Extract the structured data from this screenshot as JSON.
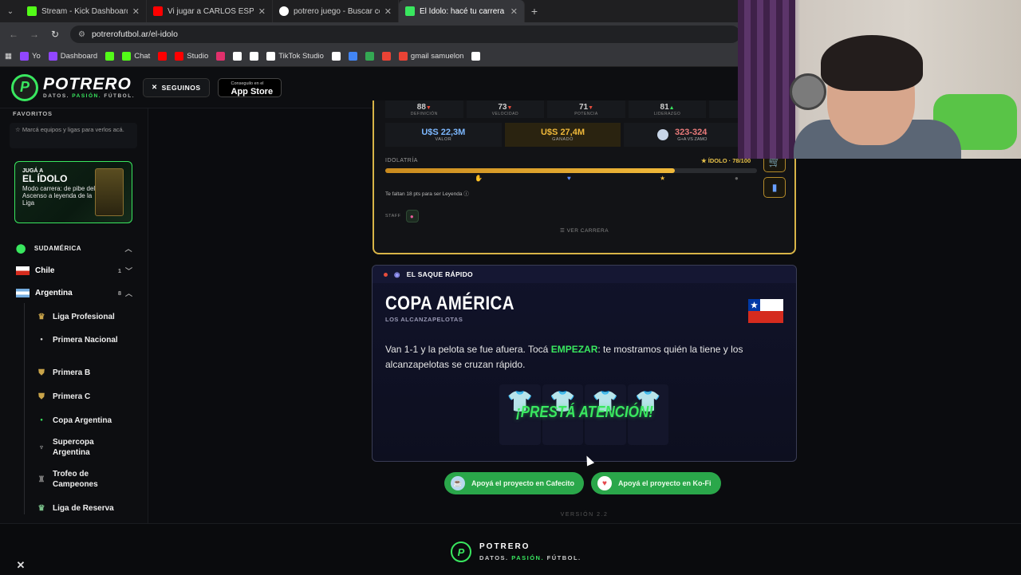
{
  "browser": {
    "tabs": [
      {
        "title": "Stream - Kick Dashboard",
        "color": "#53fc18",
        "glyph": "K"
      },
      {
        "title": "Vi jugar a CARLOS ESPÍ y descu",
        "color": "#ff0000",
        "glyph": "▶"
      },
      {
        "title": "potrero juego - Buscar con Go",
        "color": "#ffffff",
        "glyph": "G"
      },
      {
        "title": "El Ídolo: hacé tu carrera en la L",
        "color": "#39e75f",
        "glyph": "P"
      }
    ],
    "url": "potrerofutbol.ar/el-idolo",
    "bookmarks": [
      {
        "label": "Yo",
        "color": "#9146ff"
      },
      {
        "label": "Dashboard",
        "color": "#9146ff"
      },
      {
        "label": "",
        "color": "#53fc18"
      },
      {
        "label": "Chat",
        "color": "#53fc18"
      },
      {
        "label": "",
        "color": "#ff0000"
      },
      {
        "label": "Studio",
        "color": "#ff0000"
      },
      {
        "label": "",
        "color": "#e1306c"
      },
      {
        "label": "",
        "color": "#ffffff"
      },
      {
        "label": "",
        "color": "#ffffff"
      },
      {
        "label": "TikTok Studio",
        "color": "#ffffff"
      },
      {
        "label": "",
        "color": "#ffffff"
      },
      {
        "label": "",
        "color": "#4285f4"
      },
      {
        "label": "",
        "color": "#34a853"
      },
      {
        "label": "",
        "color": "#ea4335"
      },
      {
        "label": "gmail samuelon",
        "color": "#ea4335"
      },
      {
        "label": "",
        "color": "#ffffff"
      }
    ]
  },
  "header": {
    "brand": "POTRERO",
    "tagline_a": "DATOS.",
    "tagline_b": "PASIÓN.",
    "tagline_c": "FÚTBOL.",
    "follow_label": "SEGUINOS",
    "appstore_small": "Conseguilo en el",
    "appstore_big": "App Store"
  },
  "sidebar": {
    "favorites_title": "FAVORITOS",
    "favorites_hint": "Marcá equipos y ligas para verlos acá.",
    "promo": {
      "kicker": "JUGÁ A",
      "title": "EL ÍDOLO",
      "desc": "Modo carrera: de pibe del Ascenso a leyenda de la Liga"
    },
    "region": "SUDAMÉRICA",
    "countries": [
      {
        "name": "Chile",
        "count": "1"
      },
      {
        "name": "Argentina",
        "count": "8"
      }
    ],
    "leagues": [
      {
        "name": "Liga Profesional",
        "icon": "trophy-icon"
      },
      {
        "name": "Primera Nacional",
        "icon": "ball-icon"
      },
      {
        "name": "Primera B",
        "icon": "shield-icon"
      },
      {
        "name": "Primera C",
        "icon": "shield-icon"
      },
      {
        "name": "Copa Argentina",
        "icon": "cup-icon"
      },
      {
        "name": "Supercopa Argentina",
        "icon": "cup-icon"
      },
      {
        "name": "Trofeo de Campeones",
        "icon": "cup-icon"
      },
      {
        "name": "Liga de Reserva",
        "icon": "trophy-icon"
      }
    ]
  },
  "career": {
    "stats": [
      {
        "value": "88",
        "arrow": "▼",
        "label": "DEFINICIÓN"
      },
      {
        "value": "73",
        "arrow": "▼",
        "label": "VELOCIDAD"
      },
      {
        "value": "71",
        "arrow": "▼",
        "label": "POTENCIA"
      },
      {
        "value": "81",
        "arrow": "▲",
        "label": "LIDERAZGO"
      },
      {
        "value": "",
        "arrow": "",
        "label": "M"
      }
    ],
    "value_amount": "U$S 22,3M",
    "value_label": "VALOR",
    "earned_amount": "U$S 27,4M",
    "earned_label": "GANADO",
    "vs_score": "323-324",
    "vs_label": "G+A VS ZAMO",
    "idolatry_label": "IDOLATRÍA",
    "idol_status": "★ ÍDOLO · 78/100",
    "idol_progress": 0.78,
    "missing_text": "Te faltan 18 pts para ser Leyenda",
    "staff_label": "STAFF",
    "see_career": "☰ VER CARRERA"
  },
  "game": {
    "header": "EL SAQUE RÁPIDO",
    "title": "COPA AMÉRICA",
    "subtitle": "LOS ALCANZAPELOTAS",
    "text_a": "Van 1-1 y la pelota se fue afuera. Tocá ",
    "text_highlight": "EMPEZAR",
    "text_b": ": te mostramos quién la tiene y los alcanzapelotas se cruzan rápido.",
    "attention": "¡PRESTÁ ATENCIÓN!"
  },
  "support": {
    "cafecito": "Apoyá el proyecto en Cafecito",
    "kofi": "Apoyá el proyecto en Ko-Fi"
  },
  "version": "VERSIÓN 2.2",
  "footer": {
    "brand": "POTRERO",
    "tag_a": "DATOS.",
    "tag_b": "PASIÓN.",
    "tag_c": "FÚTBOL."
  }
}
